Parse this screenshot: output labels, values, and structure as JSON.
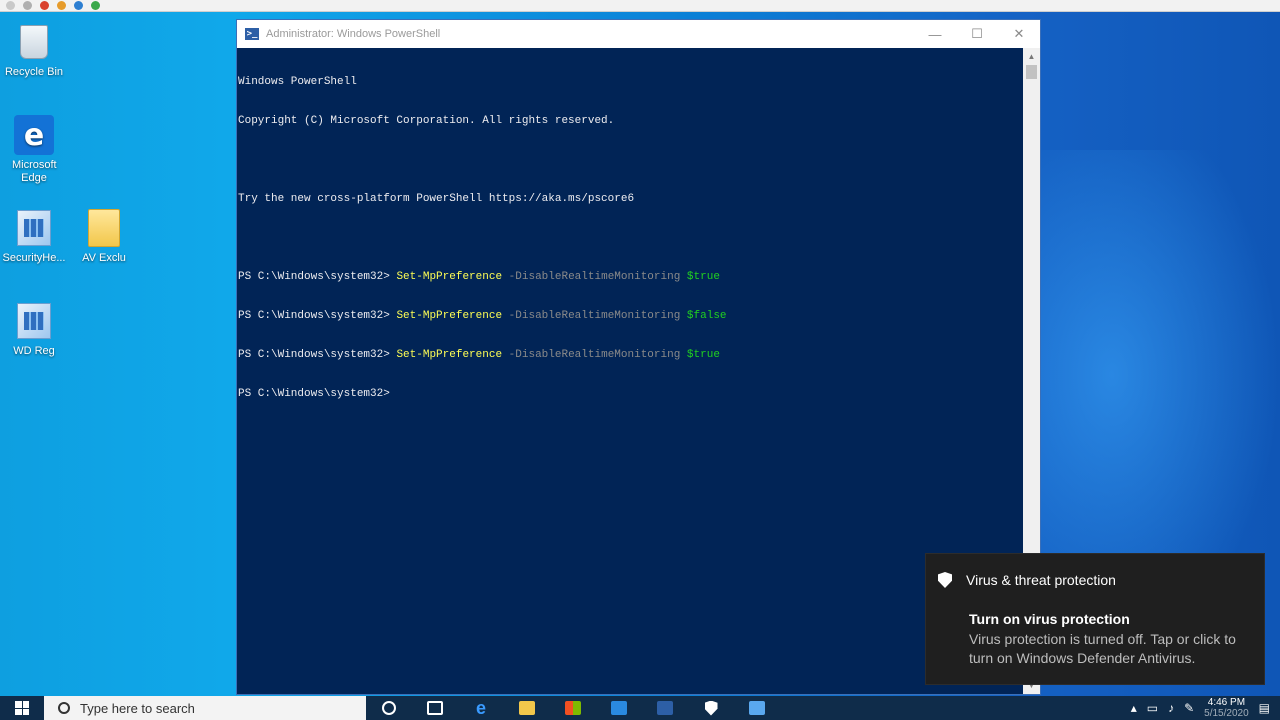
{
  "desktop": {
    "icons": [
      {
        "label": "Recycle Bin"
      },
      {
        "label": "Microsoft Edge"
      },
      {
        "label": "SecurityHe..."
      },
      {
        "label": "AV Exclu"
      },
      {
        "label": "WD Reg"
      }
    ]
  },
  "window": {
    "title": "Administrator: Windows PowerShell",
    "controls": {
      "minimize": "—",
      "maximize": "☐",
      "close": "✕"
    }
  },
  "console": {
    "banner": [
      "Windows PowerShell",
      "Copyright (C) Microsoft Corporation. All rights reserved."
    ],
    "hint": "Try the new cross-platform PowerShell https://aka.ms/pscore6",
    "prompt": "PS C:\\Windows\\system32> ",
    "commands": [
      {
        "cmdlet": "Set-MpPreference",
        "param": "-DisableRealtimeMonitoring",
        "value": "$true"
      },
      {
        "cmdlet": "Set-MpPreference",
        "param": "-DisableRealtimeMonitoring",
        "value": "$false"
      },
      {
        "cmdlet": "Set-MpPreference",
        "param": "-DisableRealtimeMonitoring",
        "value": "$true"
      }
    ]
  },
  "toast": {
    "app": "Virus & threat protection",
    "heading": "Turn on virus protection",
    "body": "Virus protection is turned off. Tap or click to turn on Windows Defender Antivirus."
  },
  "taskbar": {
    "search_placeholder": "Type here to search",
    "time": "4:46 PM",
    "date": "5/15/2020"
  },
  "colors": {
    "console_bg": "#012456",
    "cmdlet": "#fefe54",
    "param": "#8a8a8a",
    "variable": "#20d020"
  }
}
